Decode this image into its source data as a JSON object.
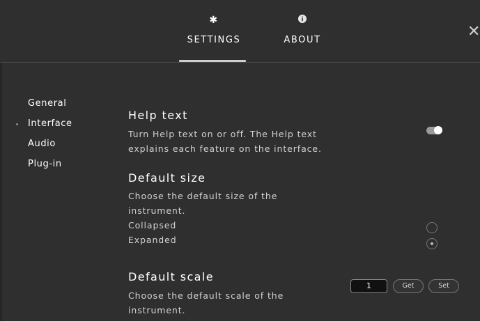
{
  "tabs": [
    {
      "label": "SETTINGS",
      "icon": "gear-icon",
      "selected": true
    },
    {
      "label": "ABOUT",
      "icon": "info-icon",
      "selected": false
    }
  ],
  "close_icon": "close-icon",
  "sidebar": {
    "items": [
      {
        "label": "General",
        "active": false
      },
      {
        "label": "Interface",
        "active": true
      },
      {
        "label": "Audio",
        "active": false
      },
      {
        "label": "Plug-in",
        "active": false
      }
    ]
  },
  "help_text": {
    "title": "Help text",
    "desc1": "Turn Help text on or off. The Help text",
    "desc2": "explains each feature on the interface.",
    "enabled": true
  },
  "default_size": {
    "title": "Default size",
    "desc1": "Choose the default size of the",
    "desc2": "instrument.",
    "options": [
      "Collapsed",
      "Expanded"
    ],
    "selected": "Expanded"
  },
  "default_scale": {
    "title": "Default scale",
    "desc1": "Choose the default scale of the",
    "desc2": "instrument.",
    "value": "1",
    "get_label": "Get",
    "set_label": "Set"
  },
  "colors": {
    "background": "#2f2f2f",
    "text": "#ffffff",
    "muted": "#d2d2d2"
  }
}
